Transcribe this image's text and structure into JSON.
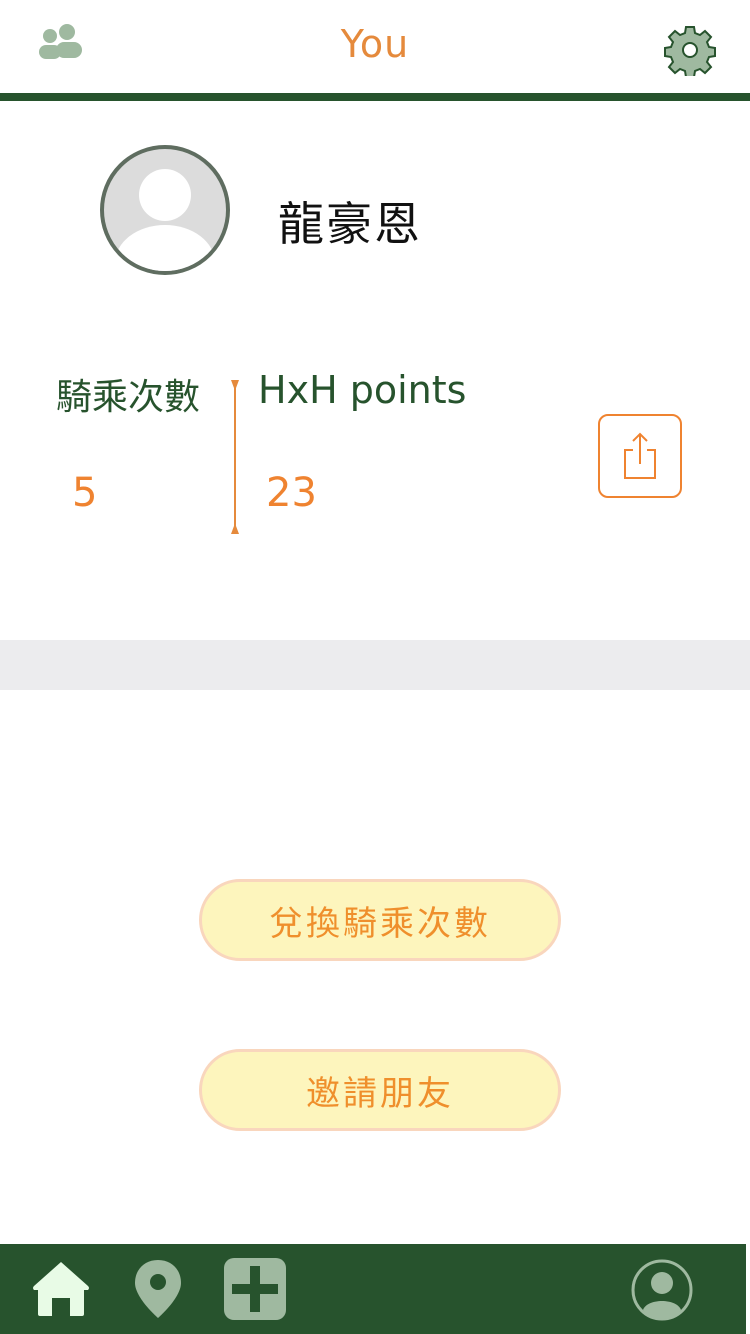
{
  "header": {
    "title": "You",
    "left_icon": "friends-icon",
    "right_icon": "gear-icon"
  },
  "profile": {
    "name": "龍豪恩",
    "avatar_icon": "default-avatar-icon"
  },
  "stats": {
    "rides_label": "騎乘次數",
    "rides_value": "5",
    "points_label": "HxH points",
    "points_value": "23",
    "share_icon": "share-icon"
  },
  "actions": {
    "redeem_label": "兌換騎乘次數",
    "invite_label": "邀請朋友"
  },
  "bottom_nav": {
    "items": [
      "home-icon",
      "map-pin-icon",
      "add-icon",
      "profile-icon"
    ]
  },
  "colors": {
    "brand_green": "#27532d",
    "accent_orange": "#ef8330",
    "pill_fill": "#fdf5bd",
    "pill_border": "#f9d6bd",
    "band_gray": "#ececee"
  }
}
